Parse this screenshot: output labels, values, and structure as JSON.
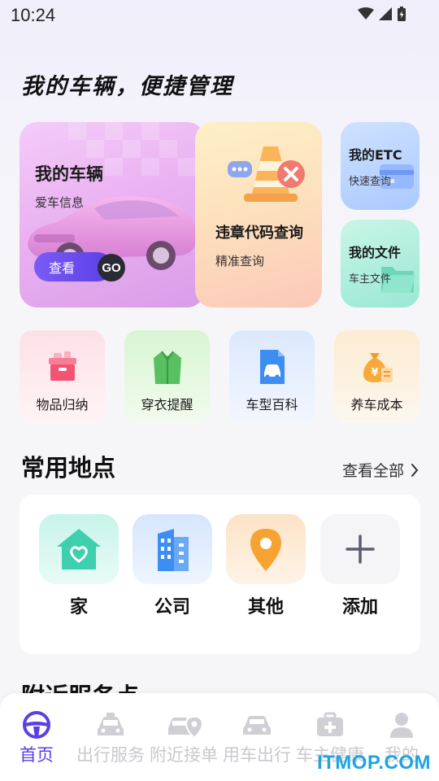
{
  "status_bar": {
    "time": "10:24"
  },
  "headline": "我的车辆，便捷管理",
  "cards": {
    "my_vehicle": {
      "title": "我的车辆",
      "subtitle": "爱车信息",
      "button_label": "查看",
      "badge": "GO"
    },
    "violation": {
      "title": "违章代码查询",
      "subtitle": "精准查询"
    },
    "etc": {
      "title": "我的ETC",
      "subtitle": "快速查询"
    },
    "files": {
      "title": "我的文件",
      "subtitle": "车主文件"
    }
  },
  "quick_actions": [
    {
      "label": "物品归纳",
      "icon": "box-icon"
    },
    {
      "label": "穿衣提醒",
      "icon": "jacket-icon"
    },
    {
      "label": "车型百科",
      "icon": "car-document-icon"
    },
    {
      "label": "养车成本",
      "icon": "money-bag-icon"
    }
  ],
  "places": {
    "title": "常用地点",
    "view_all": "查看全部",
    "items": [
      {
        "label": "家",
        "icon": "home-icon"
      },
      {
        "label": "公司",
        "icon": "building-icon"
      },
      {
        "label": "其他",
        "icon": "location-pin-icon"
      },
      {
        "label": "添加",
        "icon": "plus-icon"
      }
    ]
  },
  "nearby": {
    "title": "附近服务点"
  },
  "tabs": [
    {
      "label": "首页",
      "active": true
    },
    {
      "label": "出行服务"
    },
    {
      "label": "附近接单"
    },
    {
      "label": "用车出行"
    },
    {
      "label": "车主健康"
    },
    {
      "label": "我的"
    }
  ],
  "watermark": "ITMOP.COM",
  "colors": {
    "accent": "#5b3ee6",
    "inactive_tab": "#c9c9cf"
  }
}
